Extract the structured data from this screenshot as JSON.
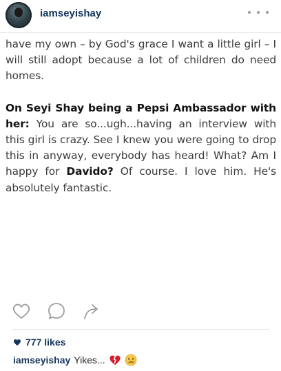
{
  "post": {
    "username": "iamseyishay",
    "caption_lines": {
      "p1": "have my own – by God's grace I want a little girl – I will still adopt because a lot of children do need homes.",
      "p2_bold": "On Seyi Shay being a Pepsi Ambassador with her:",
      "p2_text": " You are so...ugh...having an interview with this girl is crazy. See I knew you were going to drop this in anyway, everybody has heard! What? Am I happy for ",
      "p2_bold2": "Davido?",
      "p2_end": " Of course. I love him. He's absolutely fantastic."
    },
    "likes_text": "777 likes",
    "comment": {
      "user": "iamseyishay",
      "text": "Yikes..."
    }
  },
  "colors": {
    "username": "#16375d",
    "text": "#3b3b3b",
    "divider": "#e6e6e6",
    "icon": "#9b9b9b"
  },
  "icons": [
    "more-icon",
    "heart-outline-icon",
    "comment-icon",
    "share-icon",
    "heart-filled-icon",
    "broken-heart-emoji",
    "crying-face-emoji"
  ]
}
